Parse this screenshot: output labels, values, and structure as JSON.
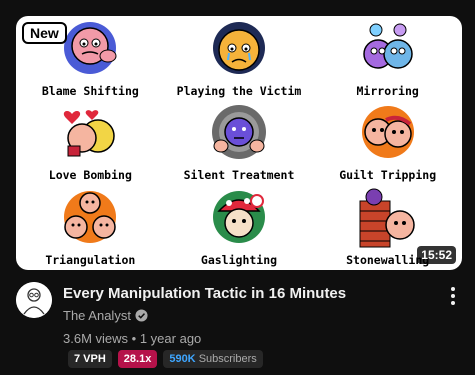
{
  "thumbnail": {
    "badge": "New",
    "duration": "15:52",
    "captions": [
      "Blame Shifting",
      "Playing the Victim",
      "Mirroring",
      "Love Bombing",
      "Silent Treatment",
      "Guilt Tripping",
      "Triangulation",
      "Gaslighting",
      "Stonewalling"
    ]
  },
  "video": {
    "title": "Every Manipulation Tactic in 16 Minutes",
    "channel": "The Analyst",
    "views": "3.6M views",
    "separator": "•",
    "age": "1 year ago"
  },
  "chips": {
    "vph": "7 VPH",
    "multiplier": "28.1x",
    "subs_count": "590K",
    "subs_label": "Subscribers"
  },
  "colors": {
    "background": "#0f0f0f",
    "secondary_text": "#aaaaaa",
    "multiplier_chip": "#b5124a",
    "subs_accent": "#3ea6ff"
  }
}
